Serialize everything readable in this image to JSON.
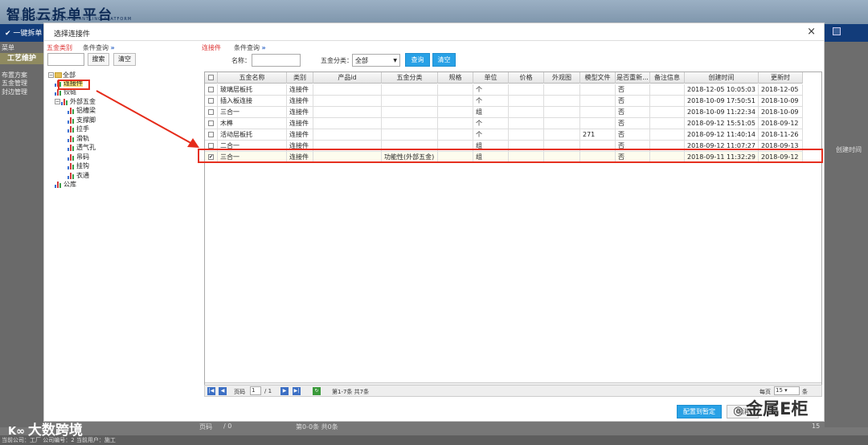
{
  "app": {
    "title": "智能云拆单平台",
    "subtitle": "INTELLIGENT CLOUD DISMANTLING PLATFORM",
    "nav_button": "一键拆单"
  },
  "background": {
    "menu_title": "菜单",
    "tab": "工艺维护",
    "left_items": [
      "布置方案",
      "五金管理",
      "封边管理"
    ],
    "right_col_header": "创建时间",
    "pager": "第0-0条 共0条",
    "page_label": "页码",
    "page_total": "/ 0",
    "status_bar": "当前公司：工厂  公司编号：2  当前用户：施工",
    "page_size": "15"
  },
  "dialog": {
    "title": "选择连接件",
    "close": "×",
    "left_panel": {
      "category_label": "五金类别",
      "condition_label": "条件查询",
      "search_button": "搜索",
      "clear_button": "清空",
      "tree": [
        {
          "label": "全部",
          "level": 0
        },
        {
          "label": "连接件",
          "level": 1,
          "selected": true
        },
        {
          "label": "铰链",
          "level": 1
        },
        {
          "label": "外部五金",
          "level": 1
        },
        {
          "label": "铝槽梁",
          "level": 2
        },
        {
          "label": "支撑脚",
          "level": 2
        },
        {
          "label": "拉手",
          "level": 2
        },
        {
          "label": "滑轨",
          "level": 2
        },
        {
          "label": "透气孔",
          "level": 2
        },
        {
          "label": "吊码",
          "level": 2
        },
        {
          "label": "挂钩",
          "level": 2
        },
        {
          "label": "衣通",
          "level": 2
        },
        {
          "label": "公库",
          "level": 1
        }
      ]
    },
    "right_panel": {
      "category_label": "连接件",
      "condition_label": "条件查询",
      "name_label": "名称：",
      "name_value": "",
      "type_label": "五金分类：",
      "type_value": "全部",
      "query_button": "查询",
      "clear_button": "清空"
    },
    "grid": {
      "columns": [
        "",
        "五金名称",
        "类别",
        "产品id",
        "五金分类",
        "规格",
        "单位",
        "价格",
        "外观图",
        "模型文件",
        "是否重新...",
        "备注信息",
        "创建时间",
        "更新时"
      ],
      "rows": [
        {
          "checked": false,
          "name": "玻璃层板托",
          "type": "连接件",
          "pid": "",
          "cat": "",
          "spec": "",
          "unit": "个",
          "price": "",
          "img": "",
          "model": "",
          "rebuild": "否",
          "note": "",
          "created": "2018-12-05 10:05:03",
          "updated": "2018-12-05"
        },
        {
          "checked": false,
          "name": "插入板连接",
          "type": "连接件",
          "pid": "",
          "cat": "",
          "spec": "",
          "unit": "个",
          "price": "",
          "img": "",
          "model": "",
          "rebuild": "否",
          "note": "",
          "created": "2018-10-09 17:50:51",
          "updated": "2018-10-09"
        },
        {
          "checked": false,
          "name": "三合一",
          "type": "连接件",
          "pid": "",
          "cat": "",
          "spec": "",
          "unit": "组",
          "price": "",
          "img": "",
          "model": "",
          "rebuild": "否",
          "note": "",
          "created": "2018-10-09 11:22:34",
          "updated": "2018-10-09"
        },
        {
          "checked": false,
          "name": "木榫",
          "type": "连接件",
          "pid": "",
          "cat": "",
          "spec": "",
          "unit": "个",
          "price": "",
          "img": "",
          "model": "",
          "rebuild": "否",
          "note": "",
          "created": "2018-09-12 15:51:05",
          "updated": "2018-09-12"
        },
        {
          "checked": false,
          "name": "活动层板托",
          "type": "连接件",
          "pid": "",
          "cat": "",
          "spec": "",
          "unit": "个",
          "price": "",
          "img": "",
          "model": "271",
          "rebuild": "否",
          "note": "",
          "created": "2018-09-12 11:40:14",
          "updated": "2018-11-26"
        },
        {
          "checked": false,
          "name": "二合一",
          "type": "连接件",
          "pid": "",
          "cat": "",
          "spec": "",
          "unit": "组",
          "price": "",
          "img": "",
          "model": "",
          "rebuild": "否",
          "note": "",
          "created": "2018-09-12 11:07:27",
          "updated": "2018-09-13"
        },
        {
          "checked": true,
          "name": "三合一",
          "type": "连接件",
          "pid": "",
          "cat": "功能性(外部五金)",
          "spec": "",
          "unit": "组",
          "price": "",
          "img": "",
          "model": "",
          "rebuild": "否",
          "note": "",
          "created": "2018-09-11 11:32:29",
          "updated": "2018-09-12"
        }
      ]
    },
    "pager": {
      "page_label": "页码",
      "page_value": "1",
      "page_total": "/ 1",
      "range": "第1-7条  共7条",
      "per_page_label": "每页",
      "per_page_value": "15",
      "unit": "条"
    },
    "footer": {
      "confirm_button": "配置到暂定",
      "cancel_button": "取消"
    }
  },
  "watermarks": {
    "left": "大数跨境",
    "right": "金属E柜"
  }
}
